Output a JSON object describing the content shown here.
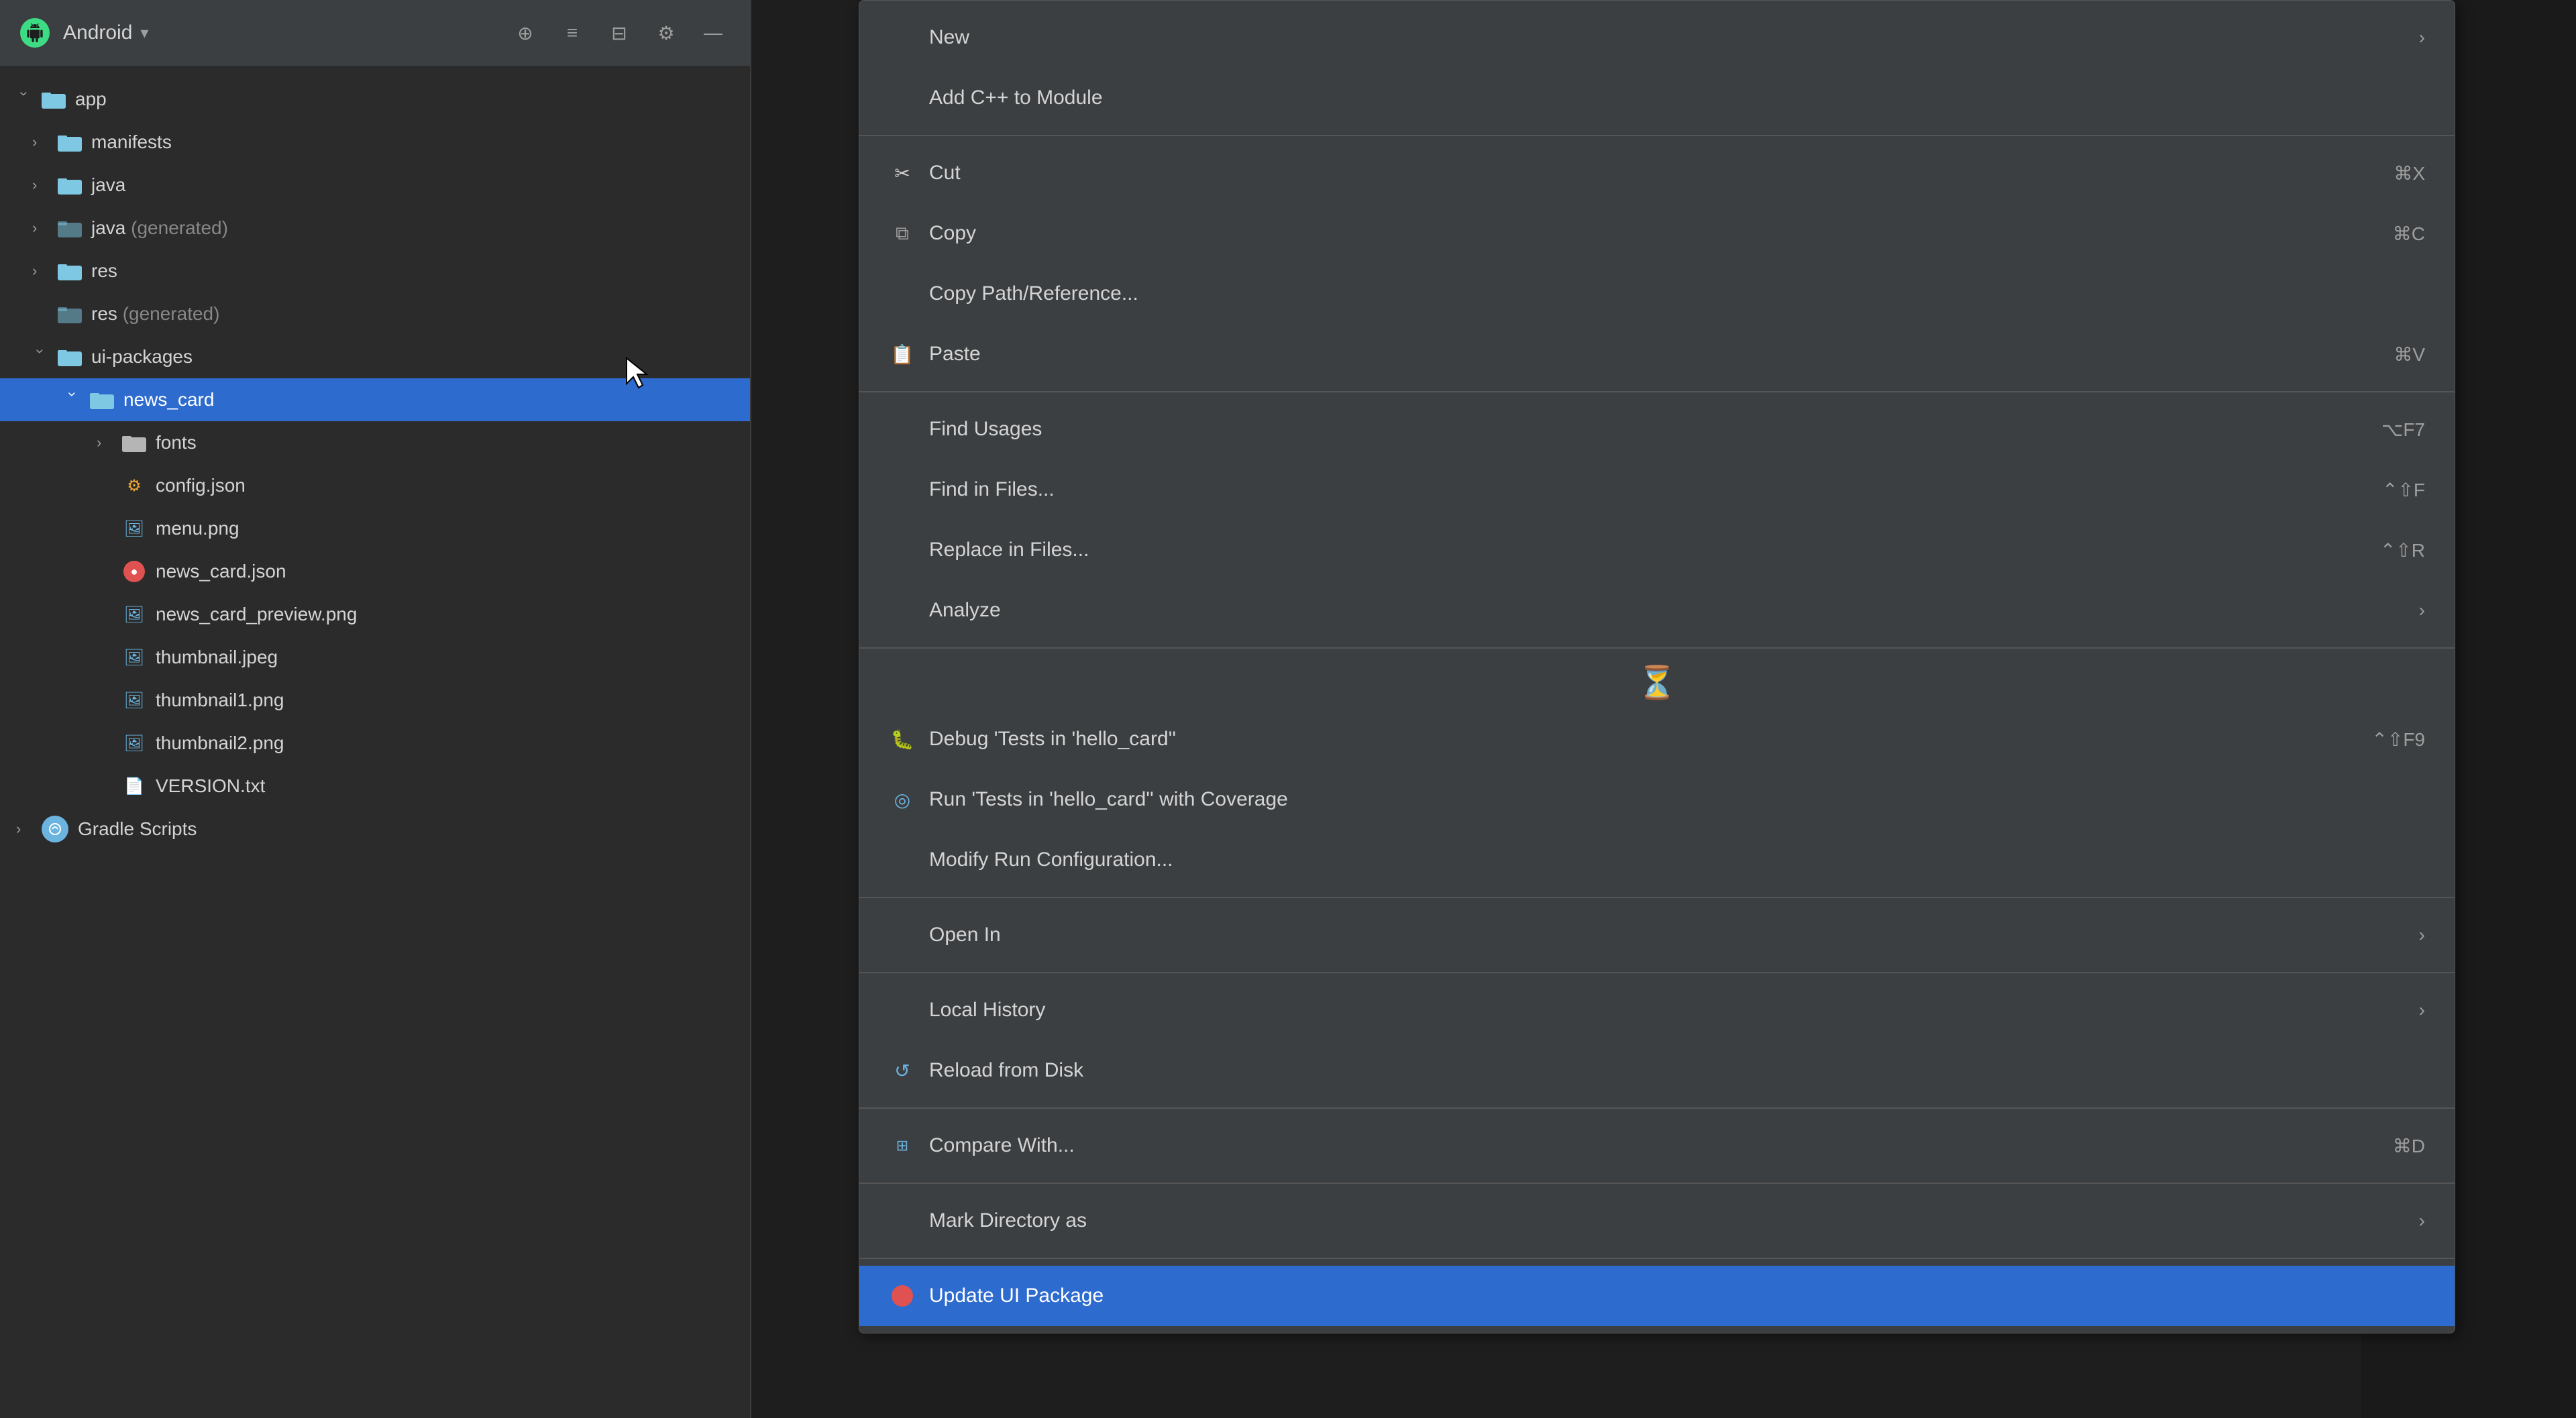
{
  "toolbar": {
    "title": "Android",
    "dropdown_label": "Android",
    "icon_label": "A"
  },
  "filetree": {
    "items": [
      {
        "id": "app",
        "label": "app",
        "level": 0,
        "type": "folder",
        "expanded": true,
        "selected": false
      },
      {
        "id": "manifests",
        "label": "manifests",
        "level": 1,
        "type": "folder",
        "expanded": false,
        "selected": false
      },
      {
        "id": "java",
        "label": "java",
        "level": 1,
        "type": "folder",
        "expanded": false,
        "selected": false
      },
      {
        "id": "java-gen",
        "label": "java (generated)",
        "level": 1,
        "type": "folder-gen",
        "expanded": false,
        "selected": false
      },
      {
        "id": "res",
        "label": "res",
        "level": 1,
        "type": "folder",
        "expanded": false,
        "selected": false
      },
      {
        "id": "res-gen",
        "label": "res (generated)",
        "level": 1,
        "type": "folder-gen",
        "expanded": false,
        "selected": false
      },
      {
        "id": "ui-packages",
        "label": "ui-packages",
        "level": 1,
        "type": "folder",
        "expanded": true,
        "selected": false
      },
      {
        "id": "news_card",
        "label": "news_card",
        "level": 2,
        "type": "folder",
        "expanded": true,
        "selected": true
      },
      {
        "id": "fonts",
        "label": "fonts",
        "level": 3,
        "type": "folder-plain",
        "expanded": false,
        "selected": false
      },
      {
        "id": "config-json",
        "label": "config.json",
        "level": 3,
        "type": "file-json",
        "selected": false
      },
      {
        "id": "menu-png",
        "label": "menu.png",
        "level": 3,
        "type": "file-img",
        "selected": false
      },
      {
        "id": "news-card-json",
        "label": "news_card.json",
        "level": 3,
        "type": "file-json-red",
        "selected": false
      },
      {
        "id": "news-card-preview",
        "label": "news_card_preview.png",
        "level": 3,
        "type": "file-img",
        "selected": false
      },
      {
        "id": "thumbnail-jpeg",
        "label": "thumbnail.jpeg",
        "level": 3,
        "type": "file-img",
        "selected": false
      },
      {
        "id": "thumbnail1-png",
        "label": "thumbnail1.png",
        "level": 3,
        "type": "file-img",
        "selected": false
      },
      {
        "id": "thumbnail2-png",
        "label": "thumbnail2.png",
        "level": 3,
        "type": "file-img",
        "selected": false
      },
      {
        "id": "version-txt",
        "label": "VERSION.txt",
        "level": 3,
        "type": "file-txt",
        "selected": false
      },
      {
        "id": "gradle",
        "label": "Gradle Scripts",
        "level": 0,
        "type": "gradle",
        "expanded": false,
        "selected": false
      }
    ]
  },
  "context_menu": {
    "items": [
      {
        "id": "new",
        "label": "New",
        "icon": "new",
        "shortcut": "",
        "arrow": true,
        "separator_after": false
      },
      {
        "id": "add-cpp",
        "label": "Add C++ to Module",
        "icon": "",
        "shortcut": "",
        "arrow": false,
        "separator_after": true
      },
      {
        "id": "cut",
        "label": "Cut",
        "icon": "scissors",
        "shortcut": "⌘X",
        "arrow": false,
        "separator_after": false
      },
      {
        "id": "copy",
        "label": "Copy",
        "icon": "copy",
        "shortcut": "⌘C",
        "arrow": false,
        "separator_after": false
      },
      {
        "id": "copy-path",
        "label": "Copy Path/Reference...",
        "icon": "",
        "shortcut": "",
        "arrow": false,
        "separator_after": false
      },
      {
        "id": "paste",
        "label": "Paste",
        "icon": "paste",
        "shortcut": "⌘V",
        "arrow": false,
        "separator_after": true
      },
      {
        "id": "find-usages",
        "label": "Find Usages",
        "icon": "",
        "shortcut": "⌥F7",
        "arrow": false,
        "separator_after": false
      },
      {
        "id": "find-in-files",
        "label": "Find in Files...",
        "icon": "",
        "shortcut": "⌃⇧F",
        "arrow": false,
        "separator_after": false
      },
      {
        "id": "replace-in-files",
        "label": "Replace in Files...",
        "icon": "",
        "shortcut": "⌃⇧R",
        "arrow": false,
        "separator_after": false
      },
      {
        "id": "analyze",
        "label": "Analyze",
        "icon": "",
        "shortcut": "",
        "arrow": true,
        "separator_after": true
      },
      {
        "id": "spinner",
        "label": "",
        "icon": "spinner",
        "shortcut": "",
        "arrow": false,
        "separator_after": false
      },
      {
        "id": "debug",
        "label": "Debug 'Tests in 'hello_card''",
        "icon": "debug",
        "shortcut": "⌃⇧F9",
        "arrow": false,
        "separator_after": false
      },
      {
        "id": "coverage",
        "label": "Run 'Tests in 'hello_card'' with Coverage",
        "icon": "coverage",
        "shortcut": "",
        "arrow": false,
        "separator_after": false
      },
      {
        "id": "modify-run",
        "label": "Modify Run Configuration...",
        "icon": "",
        "shortcut": "",
        "arrow": false,
        "separator_after": true
      },
      {
        "id": "open-in",
        "label": "Open In",
        "icon": "",
        "shortcut": "",
        "arrow": true,
        "separator_after": true
      },
      {
        "id": "local-history",
        "label": "Local History",
        "icon": "",
        "shortcut": "",
        "arrow": true,
        "separator_after": false
      },
      {
        "id": "reload",
        "label": "Reload from Disk",
        "icon": "reload",
        "shortcut": "",
        "arrow": false,
        "separator_after": true
      },
      {
        "id": "compare",
        "label": "Compare With...",
        "icon": "compare",
        "shortcut": "⌘D",
        "arrow": false,
        "separator_after": true
      },
      {
        "id": "mark-dir",
        "label": "Mark Directory as",
        "icon": "",
        "shortcut": "",
        "arrow": true,
        "separator_after": true
      },
      {
        "id": "update-ui",
        "label": "Update UI Package",
        "icon": "update",
        "shortcut": "",
        "arrow": false,
        "separator_after": false
      }
    ]
  }
}
